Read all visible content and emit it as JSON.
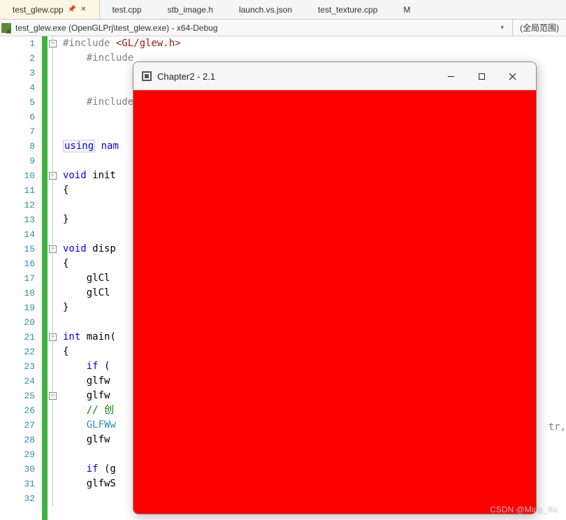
{
  "tabs": [
    {
      "label": "test_glew.cpp",
      "active": true,
      "pinned": true
    },
    {
      "label": "test.cpp"
    },
    {
      "label": "stb_image.h"
    },
    {
      "label": "launch.vs.json"
    },
    {
      "label": "test_texture.cpp"
    },
    {
      "label": "M"
    }
  ],
  "toolbar": {
    "target": "test_glew.exe (OpenGLPrj\\test_glew.exe) - x64-Debug",
    "scope": "(全局范围)"
  },
  "code": {
    "lines": [
      {
        "n": "1",
        "frag": [
          {
            "c": "pp",
            "t": "#include "
          },
          {
            "c": "inc",
            "t": "<GL/glew.h>"
          }
        ]
      },
      {
        "n": "2",
        "frag": [
          {
            "c": "pp",
            "t": "    #include"
          }
        ]
      },
      {
        "n": "3",
        "frag": []
      },
      {
        "n": "4",
        "frag": []
      },
      {
        "n": "5",
        "frag": [
          {
            "c": "pp",
            "t": "    #include"
          }
        ]
      },
      {
        "n": "6",
        "frag": []
      },
      {
        "n": "7",
        "frag": []
      },
      {
        "n": "8",
        "frag": [
          {
            "c": "kw",
            "t": "using",
            "box": true
          },
          {
            "c": "id",
            "t": " "
          },
          {
            "c": "kw",
            "t": "nam"
          }
        ]
      },
      {
        "n": "9",
        "frag": []
      },
      {
        "n": "10",
        "frag": [
          {
            "c": "kw",
            "t": "void"
          },
          {
            "c": "id",
            "t": " init"
          }
        ]
      },
      {
        "n": "11",
        "frag": [
          {
            "c": "id",
            "t": "{"
          }
        ]
      },
      {
        "n": "12",
        "frag": []
      },
      {
        "n": "13",
        "frag": [
          {
            "c": "id",
            "t": "}"
          }
        ]
      },
      {
        "n": "14",
        "frag": []
      },
      {
        "n": "15",
        "frag": [
          {
            "c": "kw",
            "t": "void"
          },
          {
            "c": "id",
            "t": " disp"
          }
        ]
      },
      {
        "n": "16",
        "frag": [
          {
            "c": "id",
            "t": "{"
          }
        ]
      },
      {
        "n": "17",
        "frag": [
          {
            "c": "id",
            "t": "    glCl"
          }
        ]
      },
      {
        "n": "18",
        "frag": [
          {
            "c": "id",
            "t": "    glCl"
          }
        ]
      },
      {
        "n": "19",
        "frag": [
          {
            "c": "id",
            "t": "}"
          }
        ]
      },
      {
        "n": "20",
        "frag": []
      },
      {
        "n": "21",
        "frag": [
          {
            "c": "kw",
            "t": "int"
          },
          {
            "c": "id",
            "t": " main("
          }
        ]
      },
      {
        "n": "22",
        "frag": [
          {
            "c": "id",
            "t": "{"
          }
        ]
      },
      {
        "n": "23",
        "frag": [
          {
            "c": "kw",
            "t": "    if"
          },
          {
            "c": "id",
            "t": " ("
          }
        ]
      },
      {
        "n": "24",
        "frag": [
          {
            "c": "id",
            "t": "    glfw"
          }
        ]
      },
      {
        "n": "25",
        "frag": [
          {
            "c": "id",
            "t": "    glfw"
          }
        ]
      },
      {
        "n": "26",
        "frag": [
          {
            "c": "cm",
            "t": "    // 创"
          }
        ]
      },
      {
        "n": "27",
        "frag": [
          {
            "c": "ty",
            "t": "    GLFWw"
          }
        ]
      },
      {
        "n": "28",
        "frag": [
          {
            "c": "id",
            "t": "    glfw"
          }
        ]
      },
      {
        "n": "29",
        "frag": []
      },
      {
        "n": "30",
        "frag": [
          {
            "c": "kw",
            "t": "    if"
          },
          {
            "c": "id",
            "t": " (g"
          }
        ]
      },
      {
        "n": "31",
        "frag": [
          {
            "c": "id",
            "t": "    glfwS"
          }
        ]
      },
      {
        "n": "32",
        "frag": []
      }
    ]
  },
  "popup": {
    "title": "Chapter2 - 2.1"
  },
  "trail": "tr,",
  "watermark": "CSDN @Ming_Xu"
}
